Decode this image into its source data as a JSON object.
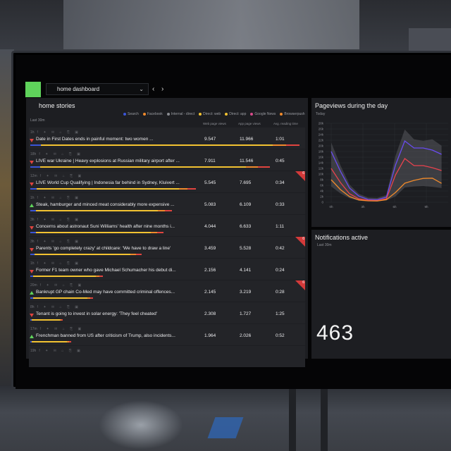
{
  "header": {
    "dashboard_name": "home dashboard",
    "prev_label": "‹",
    "next_label": "›"
  },
  "stories": {
    "title": "home stories",
    "period": "Last 30m",
    "legend": [
      {
        "label": "Search",
        "color": "#3b55d6"
      },
      {
        "label": "Facebook",
        "color": "#f08a2b"
      },
      {
        "label": "Internal - direct",
        "color": "#8a8c92"
      },
      {
        "label": "Direct: web",
        "color": "#f2c231"
      },
      {
        "label": "Direct: app",
        "color": "#f2c231"
      },
      {
        "label": "Google News",
        "color": "#d84a8a"
      },
      {
        "label": "Browserpush",
        "color": "#f08a2b"
      }
    ],
    "columns": [
      "Web page views",
      "App page views",
      "Avg. reading time"
    ],
    "rows": [
      {
        "time": "1h",
        "trend": "down",
        "title": "Date in First Dates ends in painful moment: two women ...",
        "web": "9.547",
        "app": "11.966",
        "read": "1:01",
        "flag": false,
        "bar": 0.99
      },
      {
        "time": "18h",
        "trend": "down",
        "title": "LIVE war Ukraine | Heavy explosions at Russian military airport after ...",
        "web": "7.911",
        "app": "11.546",
        "read": "0:45",
        "flag": false,
        "bar": 0.88
      },
      {
        "time": "12m",
        "trend": "down",
        "title": "LIVE World Cup Qualifying | Indonesia far behind in Sydney, Kluivert ...",
        "web": "5.545",
        "app": "7.695",
        "read": "0:34",
        "flag": true,
        "flag_n": "6",
        "bar": 0.61
      },
      {
        "time": "1h",
        "trend": "up",
        "title": "Steak, hamburger and minced meat considerably more expensive ...",
        "web": "5.083",
        "app": "6.109",
        "read": "0:33",
        "flag": false,
        "bar": 0.52
      },
      {
        "time": "3h",
        "trend": "down",
        "title": "Concerns about astronaut Suni Williams' health after nine months i...",
        "web": "4.044",
        "app": "6.633",
        "read": "1:11",
        "flag": false,
        "bar": 0.49
      },
      {
        "time": "3h",
        "trend": "down",
        "title": "Parents 'go completely crazy' at childcare: 'We have to draw a line'",
        "web": "3.459",
        "app": "5.528",
        "read": "0:42",
        "flag": true,
        "flag_n": "6",
        "bar": 0.41
      },
      {
        "time": "1h",
        "trend": "down",
        "title": "Former F1 team owner who gave Michael Schumacher his debut di...",
        "web": "2.156",
        "app": "4.141",
        "read": "0:24",
        "flag": false,
        "bar": 0.27
      },
      {
        "time": "20m",
        "trend": "up",
        "title": "Bankrupt GP chain Co-Med may have committed criminal offences...",
        "web": "2.145",
        "app": "3.219",
        "read": "0:28",
        "flag": true,
        "flag_n": "6",
        "bar": 0.23
      },
      {
        "time": "8h",
        "trend": "down",
        "title": "Tenant is going to invest in solar energy: 'They feel cheated'",
        "web": "2.308",
        "app": "1.727",
        "read": "1:25",
        "flag": false,
        "bar": 0.12
      },
      {
        "time": "17m",
        "trend": "up",
        "title": "Frenchman banned from US after criticism of Trump, also incidents...",
        "web": "1.964",
        "app": "2.026",
        "read": "0:52",
        "flag": false,
        "bar": 0.15
      },
      {
        "time": "19h",
        "trend": "down",
        "title": "",
        "web": "",
        "app": "",
        "read": "",
        "flag": false,
        "bar": 0.0
      }
    ]
  },
  "pageviews": {
    "title": "Pageviews during the day",
    "period": "Today"
  },
  "notifications": {
    "title": "Notifications active",
    "period": "Last 30m",
    "count": "463"
  },
  "chart_data": {
    "type": "line",
    "title": "Pageviews during the day",
    "ylim": [
      0,
      28000
    ],
    "yticks": [
      "0",
      "2k",
      "4k",
      "6k",
      "8k",
      "10k",
      "12k",
      "14k",
      "16k",
      "18k",
      "20k",
      "22k",
      "24k",
      "26k",
      "28k"
    ],
    "xticks": [
      "0h",
      "3h",
      "6h",
      "9h"
    ],
    "x": [
      0,
      1,
      2,
      3,
      4,
      5,
      6,
      7,
      8,
      9,
      10,
      11,
      12
    ],
    "series": [
      {
        "color": "#6a4cf0",
        "values": [
          18000,
          11000,
          5000,
          2200,
          1000,
          900,
          1800,
          14000,
          22000,
          19000,
          18500,
          19000,
          17000
        ]
      },
      {
        "color": "#e8424e",
        "values": [
          12000,
          7000,
          3000,
          1200,
          700,
          600,
          1200,
          9000,
          16000,
          13000,
          12500,
          13000,
          11500
        ]
      },
      {
        "color": "#f08a2b",
        "values": [
          8000,
          4500,
          2000,
          800,
          500,
          450,
          900,
          3000,
          7500,
          8000,
          8200,
          7800,
          7200
        ]
      }
    ],
    "grid": true
  }
}
